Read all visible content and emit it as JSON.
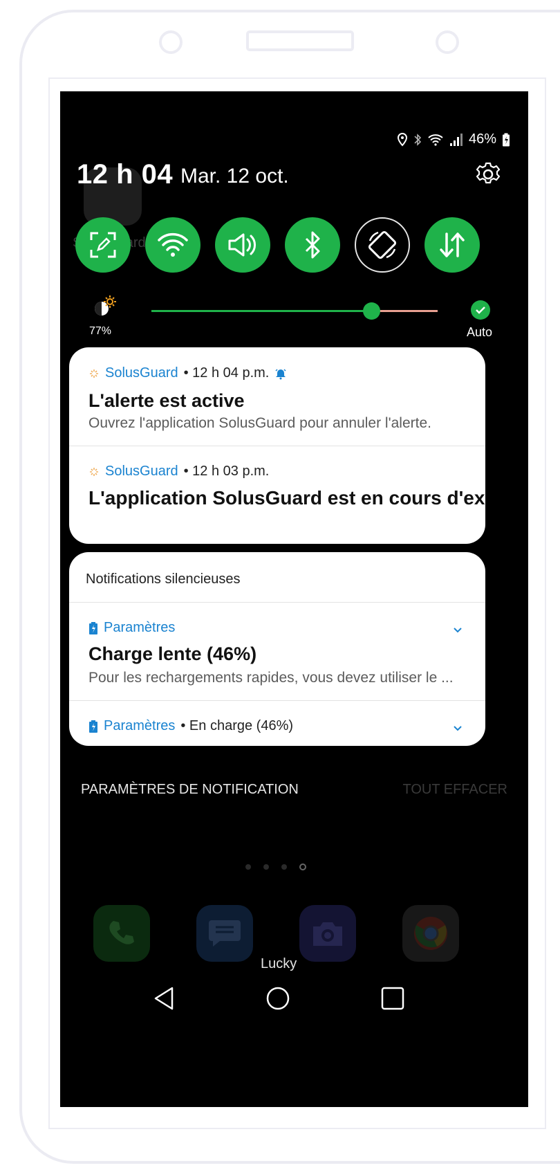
{
  "status_bar": {
    "battery_percent": "46%",
    "icons": [
      "location-icon",
      "bluetooth-icon",
      "wifi-icon",
      "signal-icon",
      "battery-icon"
    ]
  },
  "header": {
    "time": "12 h 04",
    "date": "Mar. 12 oct."
  },
  "quick_settings": [
    {
      "name": "edit-icon",
      "active": true
    },
    {
      "name": "wifi-icon",
      "active": true
    },
    {
      "name": "sound-icon",
      "active": true
    },
    {
      "name": "bluetooth-icon",
      "active": true
    },
    {
      "name": "auto-rotate-icon",
      "active": false
    },
    {
      "name": "mobile-data-icon",
      "active": true
    }
  ],
  "brightness": {
    "value_label": "77%",
    "level": 0.77,
    "auto_label": "Auto"
  },
  "notifications": [
    {
      "app": "SolusGuard",
      "time": " • 12 h 04 p.m.",
      "title": "L'alerte est active",
      "body": "Ouvrez l'application SolusGuard pour annuler l'alerte."
    },
    {
      "app": "SolusGuard",
      "time": " • 12 h 03 p.m.",
      "title": "L'application SolusGuard est en cours d'exéc.."
    }
  ],
  "silent": {
    "header": "Notifications silencieuses",
    "items": [
      {
        "app": "Paramètres",
        "title": "Charge lente (46%)",
        "body": "Pour les rechargements rapides, vous devez utiliser le ..."
      },
      {
        "app": "Paramètres",
        "extra": " • En charge (46%)"
      }
    ]
  },
  "footer": {
    "settings_label": "PARAMÈTRES DE NOTIFICATION",
    "clear_label": "TOUT EFFACER"
  },
  "home": {
    "ghost_label": "SolusGuard",
    "dock_label": "Lucky",
    "colors": {
      "accent": "#1fb24a",
      "link": "#1a83d0"
    }
  }
}
